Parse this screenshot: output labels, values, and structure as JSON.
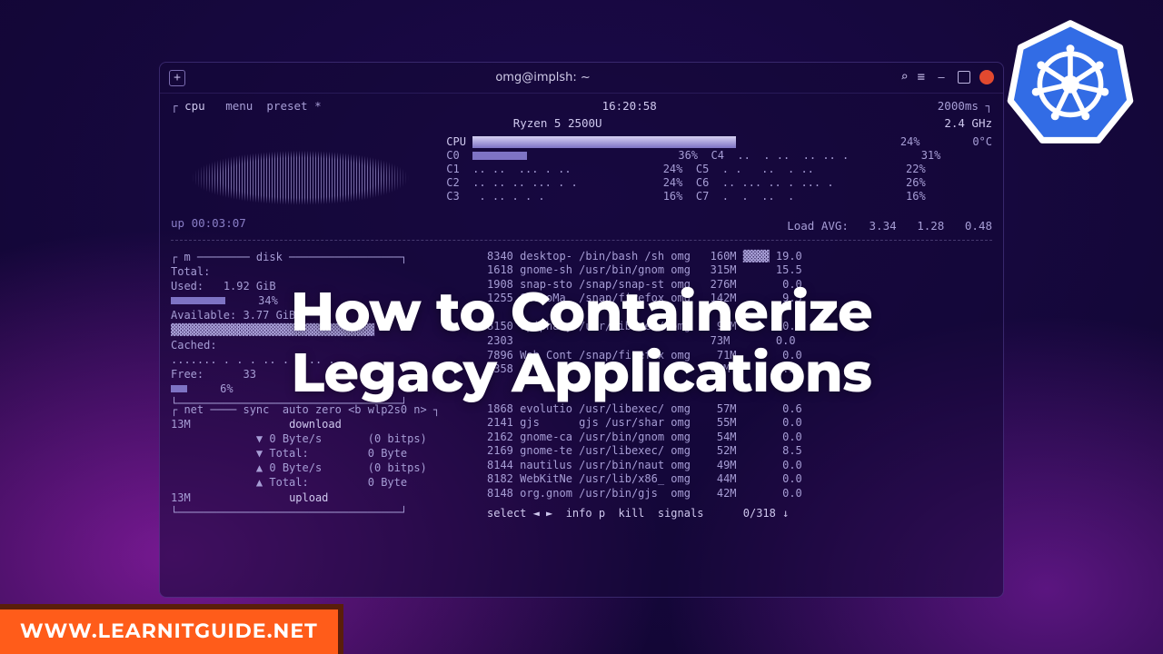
{
  "hero": {
    "line1": "How to Containerize",
    "line2": "Legacy Applications"
  },
  "site_label": "WWW.LEARNITGUIDE.NET",
  "titlebar": {
    "title": "omg@implsh: ~"
  },
  "menu": {
    "cpu": "cpu",
    "menu": "menu",
    "preset": "preset *"
  },
  "clock": "16:20:58",
  "interval": "2000ms",
  "cpu_model": "Ryzen 5 2500U",
  "ghz": "2.4 GHz",
  "cpu_total": {
    "label": "CPU",
    "pct": "24%"
  },
  "temp": "0°C",
  "cores_left": [
    {
      "name": "C0",
      "pct": "36%"
    },
    {
      "name": "C1",
      "pct": "24%"
    },
    {
      "name": "C2",
      "pct": "24%"
    },
    {
      "name": "C3",
      "pct": "16%"
    }
  ],
  "cores_right": [
    {
      "name": "C4",
      "pct": "31%"
    },
    {
      "name": "C5",
      "pct": "22%"
    },
    {
      "name": "C6",
      "pct": "26%"
    },
    {
      "name": "C7",
      "pct": "16%"
    }
  ],
  "uptime": "up 00:03:07",
  "load": {
    "label": "Load AVG:",
    "v1": "3.34",
    "v2": "1.28",
    "v3": "0.48"
  },
  "mem": {
    "total_label": "Total:",
    "used_label": "Used:",
    "used_val": "1.92 GiB",
    "used_pct": "34%",
    "avail_label": "Available:",
    "avail_val": "3.77 GiB",
    "cache_label": "Cached:",
    "free_label": "Free:",
    "free_pct": "6%",
    "free_bar": "33"
  },
  "net": {
    "header": "┌ net ──── sync  auto zero <b wlp2s0 n> ┐",
    "down": "download",
    "d1": "▼ 0 Byte/s       (0 bitps)",
    "d2": "▼ Total:         0 Byte",
    "u1": "▲ 0 Byte/s       (0 bitps)",
    "u2": "▲ Total:         0 Byte",
    "up": "upload",
    "left_top": "13M",
    "left_bot": "13M"
  },
  "procs": [
    "8340 desktop- /bin/bash /sh omg   160M ▓▓▓▓ 19.0",
    "1618 gnome-sh /usr/bin/gnom omg   315M      15.5",
    "1908 snap-sto /snap/snap-st omg   276M       0.0",
    "1255 GeckoMa  /snap/firefox omg   142M       9.5",
    "                                              ",
    "8150 epiphany /usr/libexec/ omg    94M       0.0",
    "2303                              73M       0.0",
    "7896 Web Cont /snap/firefox omg    71M       0.0",
    "5358                              64M       0.5",
    "1868 evolutio /usr/libexec/ omg    57M       0.6",
    "2141 gjs      gjs /usr/shar omg    55M       0.0",
    "2162 gnome-ca /usr/bin/gnom omg    54M       0.0",
    "2169 gnome-te /usr/libexec/ omg    52M       8.5",
    "8144 nautilus /usr/bin/naut omg    49M       0.0",
    "8182 WebKitNe /usr/lib/x86_ omg    44M       0.0",
    "8148 org.gnom /usr/bin/gjs  omg    42M       0.0"
  ],
  "footer": "select ◄ ►  info p  kill  signals      0/318 ↓"
}
